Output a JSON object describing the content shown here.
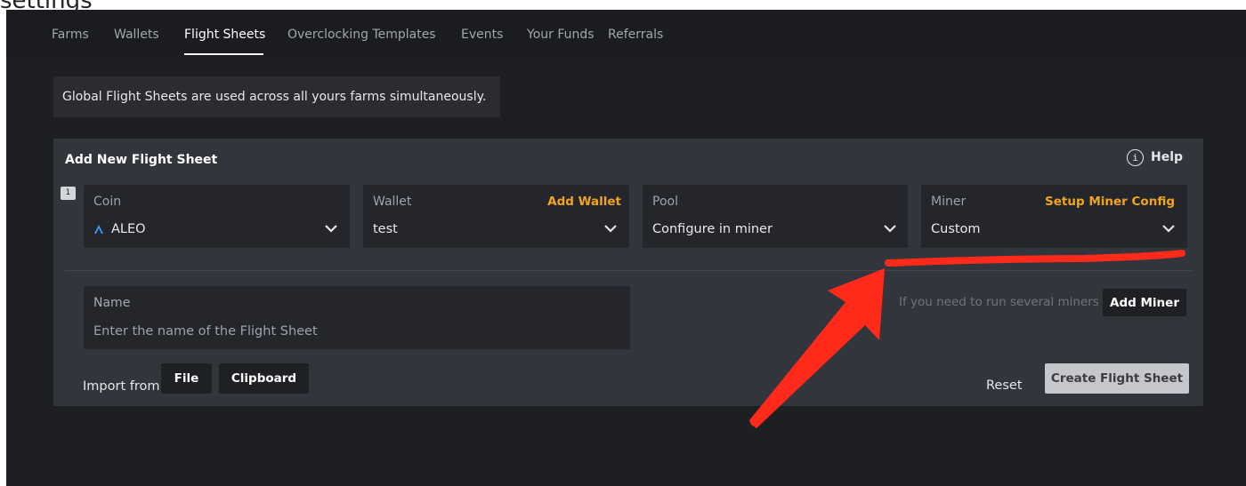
{
  "page": {
    "heading_partial": "settings"
  },
  "nav": {
    "items": [
      {
        "label": "Farms",
        "active": false
      },
      {
        "label": "Wallets",
        "active": false
      },
      {
        "label": "Flight Sheets",
        "active": true
      },
      {
        "label": "Overclocking Templates",
        "active": false
      },
      {
        "label": "Events",
        "active": false
      },
      {
        "label": "Your Funds",
        "active": false
      },
      {
        "label": "Referrals",
        "active": false
      }
    ]
  },
  "info": {
    "text": "Global Flight Sheets are used across all yours farms simultaneously."
  },
  "card": {
    "title": "Add New Flight Sheet",
    "help_icon_glyph": "i",
    "help_label": "Help",
    "row_number": "1",
    "coin": {
      "label": "Coin",
      "value": "ALEO",
      "icon": "aleo-logo-icon"
    },
    "wallet": {
      "label": "Wallet",
      "link": "Add Wallet",
      "value": "test"
    },
    "pool": {
      "label": "Pool",
      "value": "Configure in miner"
    },
    "miner": {
      "label": "Miner",
      "link": "Setup Miner Config",
      "value": "Custom"
    },
    "name": {
      "label": "Name",
      "placeholder": "Enter the name of the Flight Sheet"
    },
    "several_miners_hint": "If you need to run several miners",
    "add_miner": "Add Miner",
    "import_label": "Import from",
    "import_file": "File",
    "import_clipboard": "Clipboard",
    "reset": "Reset",
    "create": "Create Flight Sheet"
  },
  "colors": {
    "accent_link": "#f0a41c",
    "annotation": "#ff2a1a",
    "aleo_icon": "#3ea0ff"
  }
}
